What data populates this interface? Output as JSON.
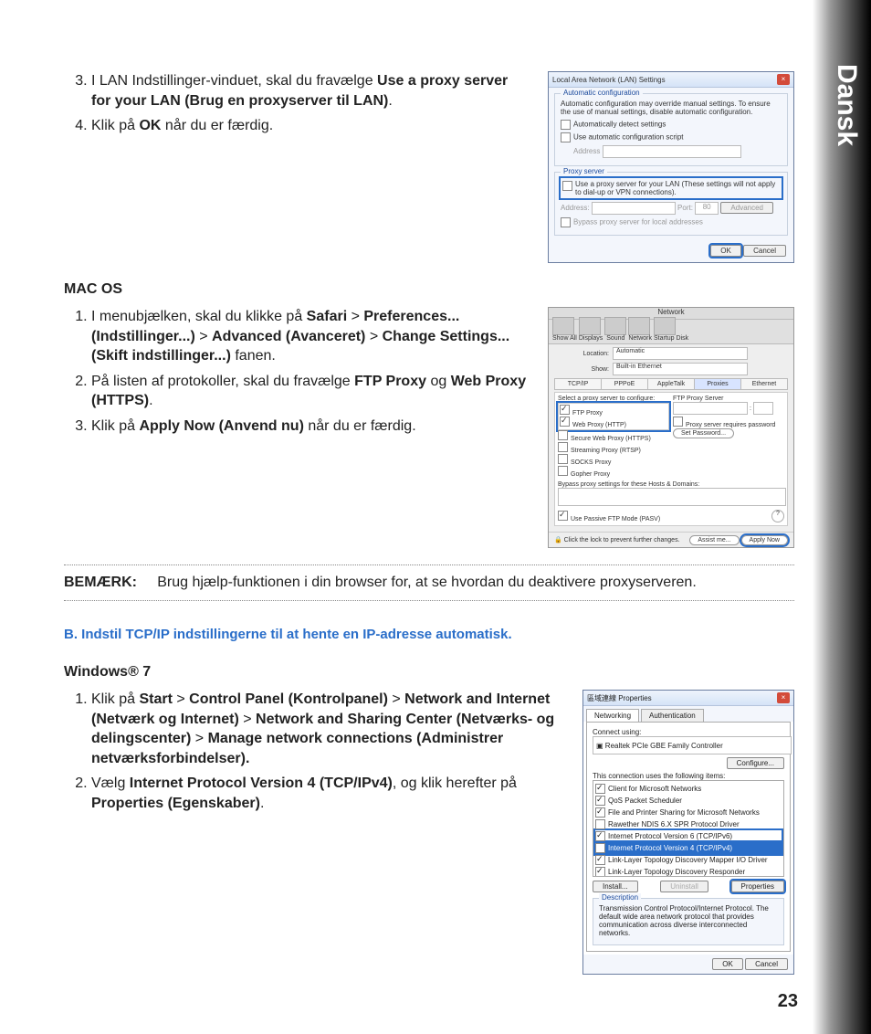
{
  "side_label": "Dansk",
  "page_number": "23",
  "top_list": {
    "start": 3,
    "items": [
      {
        "pre": "I LAN Indstillinger-vinduet, skal du fravælge ",
        "bold": "Use a proxy server for your LAN (Brug en proxyserver til LAN)",
        "post": "."
      },
      {
        "pre": "Klik på ",
        "bold": "OK",
        "post": " når du er færdig."
      }
    ]
  },
  "macos_head": "MAC OS",
  "mac_list": [
    {
      "parts": [
        "I menubjælken, skal du klikke på ",
        "Safari",
        " > ",
        "Preferences... (Indstillinger...)",
        " > ",
        "Advanced (Avanceret)",
        " > ",
        "Change Settings... (Skift indstillinger...)",
        " fanen."
      ]
    },
    {
      "parts": [
        "På listen af protokoller, skal du fravælge ",
        "FTP Proxy",
        " og ",
        "Web Proxy (HTTPS)",
        "."
      ]
    },
    {
      "parts": [
        "Klik på ",
        "Apply Now (Anvend nu)",
        " når du er færdig."
      ]
    }
  ],
  "note_label": "BEMÆRK:",
  "note_text": "Brug hjælp-funktionen i din browser for, at se hvordan du deaktivere proxyserveren.",
  "blue_head": "B.   Indstil TCP/IP indstillingerne til at hente en IP-adresse automatisk.",
  "win7_head": "Windows® 7",
  "win7_list": [
    {
      "parts": [
        "Klik på ",
        "Start",
        " > ",
        "Control Panel (Kontrolpanel)",
        " > ",
        "Network and Internet (Netværk og Internet)",
        " > ",
        "Network and Sharing Center (Netværks- og  delingscenter)",
        " > ",
        "Manage network connections (Administrer netværksforbindelser)."
      ]
    },
    {
      "parts": [
        "Vælg ",
        "Internet Protocol Version 4 (TCP/IPv4)",
        ", og klik herefter på ",
        "Properties (Egenskaber)",
        "."
      ]
    }
  ],
  "lan": {
    "title": "Local Area Network (LAN) Settings",
    "auto_group": "Automatic configuration",
    "auto_text": "Automatic configuration may override manual settings.  To ensure the use of manual settings, disable automatic configuration.",
    "auto_detect": "Automatically detect settings",
    "auto_script": "Use automatic configuration script",
    "address_lbl": "Address",
    "proxy_group": "Proxy server",
    "proxy_chk": "Use a proxy server for your LAN (These settings will not apply to dial-up or VPN connections).",
    "address2_lbl": "Address:",
    "port_lbl": "Port:",
    "port_val": "80",
    "advanced": "Advanced",
    "bypass": "Bypass proxy server for local addresses",
    "ok": "OK",
    "cancel": "Cancel"
  },
  "mac": {
    "title": "Network",
    "tb": [
      "Show All",
      "Displays",
      "Sound",
      "Network",
      "Startup Disk"
    ],
    "loc_lbl": "Location:",
    "loc_val": "Automatic",
    "show_lbl": "Show:",
    "show_val": "Built-in Ethernet",
    "tabs": [
      "TCP/IP",
      "PPPoE",
      "AppleTalk",
      "Proxies",
      "Ethernet"
    ],
    "cfg_lbl": "Select a proxy server to configure:",
    "fps_head": "FTP Proxy Server",
    "items": [
      "FTP Proxy",
      "Web Proxy (HTTP)",
      "Secure Web Proxy (HTTPS)",
      "Streaming Proxy (RTSP)",
      "SOCKS Proxy",
      "Gopher Proxy"
    ],
    "req_pw": "Proxy server requires password",
    "set_pw": "Set Password...",
    "bypass": "Bypass proxy settings for these Hosts & Domains:",
    "pasv": "Use Passive FTP Mode (PASV)",
    "lock": "Click the lock to prevent further changes.",
    "assist": "Assist me...",
    "apply": "Apply Now"
  },
  "props": {
    "title": "區域連線 Properties",
    "tab1": "Networking",
    "tab2": "Authentication",
    "connect_using": "Connect using:",
    "adapter": "Realtek PCIe GBE Family Controller",
    "configure": "Configure...",
    "uses": "This connection uses the following items:",
    "items": [
      "Client for Microsoft Networks",
      "QoS Packet Scheduler",
      "File and Printer Sharing for Microsoft Networks",
      "Rawether NDIS 6.X SPR Protocol Driver",
      "Internet Protocol Version 6 (TCP/IPv6)",
      "Internet Protocol Version 4 (TCP/IPv4)",
      "Link-Layer Topology Discovery Mapper I/O Driver",
      "Link-Layer Topology Discovery Responder"
    ],
    "install": "Install...",
    "uninstall": "Uninstall",
    "properties": "Properties",
    "desc_lbl": "Description",
    "desc": "Transmission Control Protocol/Internet Protocol. The default wide area network protocol that provides communication across diverse interconnected networks.",
    "ok": "OK",
    "cancel": "Cancel"
  }
}
